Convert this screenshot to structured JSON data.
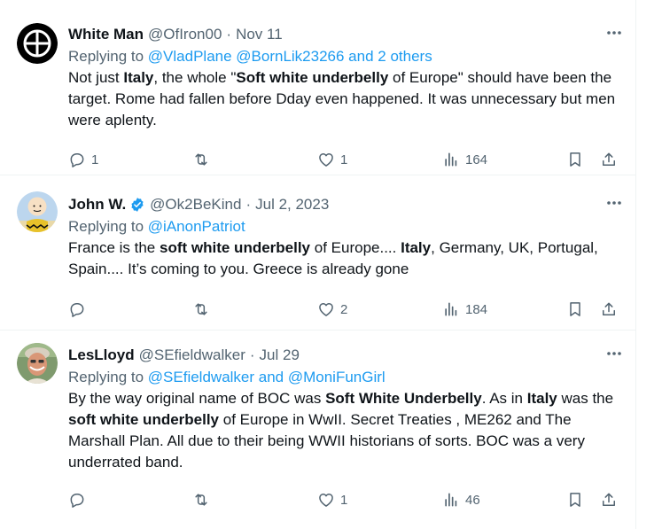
{
  "tweets": [
    {
      "name": "White Man",
      "handle": "@OfIron00",
      "date": "Nov 11",
      "verified": false,
      "reply_prefix": "Replying to",
      "reply_targets": "@VladPlane @BornLik23266 and 2 others",
      "segments": [
        {
          "t": "Not just ",
          "b": false
        },
        {
          "t": "Italy",
          "b": true
        },
        {
          "t": ", the whole \"",
          "b": false
        },
        {
          "t": "Soft white underbelly",
          "b": true
        },
        {
          "t": " of Europe\" should have been the target. Rome had fallen before Dday even happened. It was unnecessary but men were aplenty.",
          "b": false
        }
      ],
      "replies": "1",
      "retweets": "",
      "likes": "1",
      "views": "164"
    },
    {
      "name": "John W.",
      "handle": "@Ok2BeKind",
      "date": "Jul 2, 2023",
      "verified": true,
      "reply_prefix": "Replying to",
      "reply_targets": "@iAnonPatriot",
      "segments": [
        {
          "t": "France is the ",
          "b": false
        },
        {
          "t": "soft white underbelly",
          "b": true
        },
        {
          "t": " of Europe.... ",
          "b": false
        },
        {
          "t": "Italy",
          "b": true
        },
        {
          "t": ", Germany, UK, Portugal, Spain.... It’s coming to you.  Greece is already gone",
          "b": false
        }
      ],
      "replies": "",
      "retweets": "",
      "likes": "2",
      "views": "184"
    },
    {
      "name": "LesLloyd",
      "handle": "@SEfieldwalker",
      "date": "Jul 29",
      "verified": false,
      "reply_prefix": "Replying to",
      "reply_targets": "@SEfieldwalker and @MoniFunGirl",
      "segments": [
        {
          "t": "By the way original name of BOC was ",
          "b": false
        },
        {
          "t": "Soft White Underbelly",
          "b": true
        },
        {
          "t": ".   As in ",
          "b": false
        },
        {
          "t": "Italy",
          "b": true
        },
        {
          "t": " was the ",
          "b": false
        },
        {
          "t": "soft white underbelly",
          "b": true
        },
        {
          "t": " of Europe in WwII. Secret Treaties , ME262 and The Marshall Plan.  All due to their being WWII historians of sorts.  BOC was a very underrated band.",
          "b": false
        }
      ],
      "replies": "",
      "retweets": "",
      "likes": "1",
      "views": "46"
    }
  ],
  "colors": {
    "text": "#0f1419",
    "secondary": "#536471",
    "link": "#1d9bf0",
    "verified": "#1d9bf0",
    "border": "#eff3f4"
  },
  "icons": [
    "crosshair-avatar",
    "more-icon",
    "verified-badge-icon",
    "reply-icon",
    "retweet-icon",
    "like-icon",
    "views-icon",
    "bookmark-icon",
    "share-icon"
  ]
}
